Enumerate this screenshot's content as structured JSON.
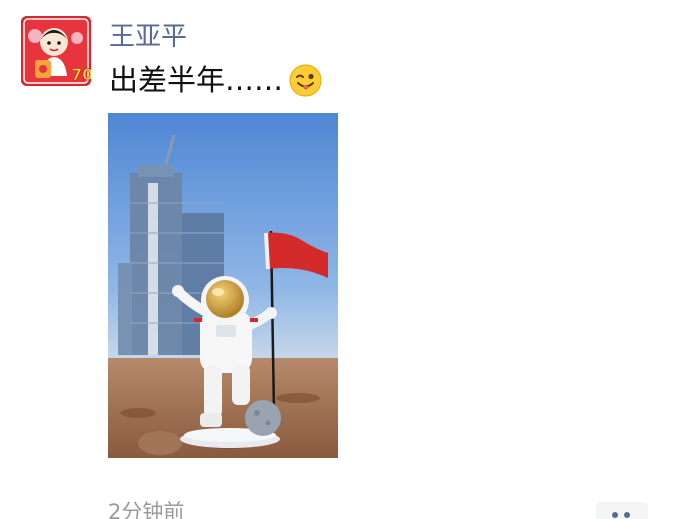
{
  "post": {
    "author": "王亚平",
    "text": "出差半年……",
    "emoji": "winking-face-with-tongue-icon",
    "photo": {
      "description_icon": "astronaut-figurine-with-red-flag-photo"
    },
    "timestamp": "2分钟前",
    "more_icon": "ellipsis-icon"
  },
  "colors": {
    "author_link": "#576b95",
    "text": "#111111",
    "timestamp": "#9a9a9a",
    "avatar_bg": "#e0323a",
    "flag_red": "#d42a2a",
    "sky": "#5a8fd6",
    "ground": "#9b6a4c"
  }
}
